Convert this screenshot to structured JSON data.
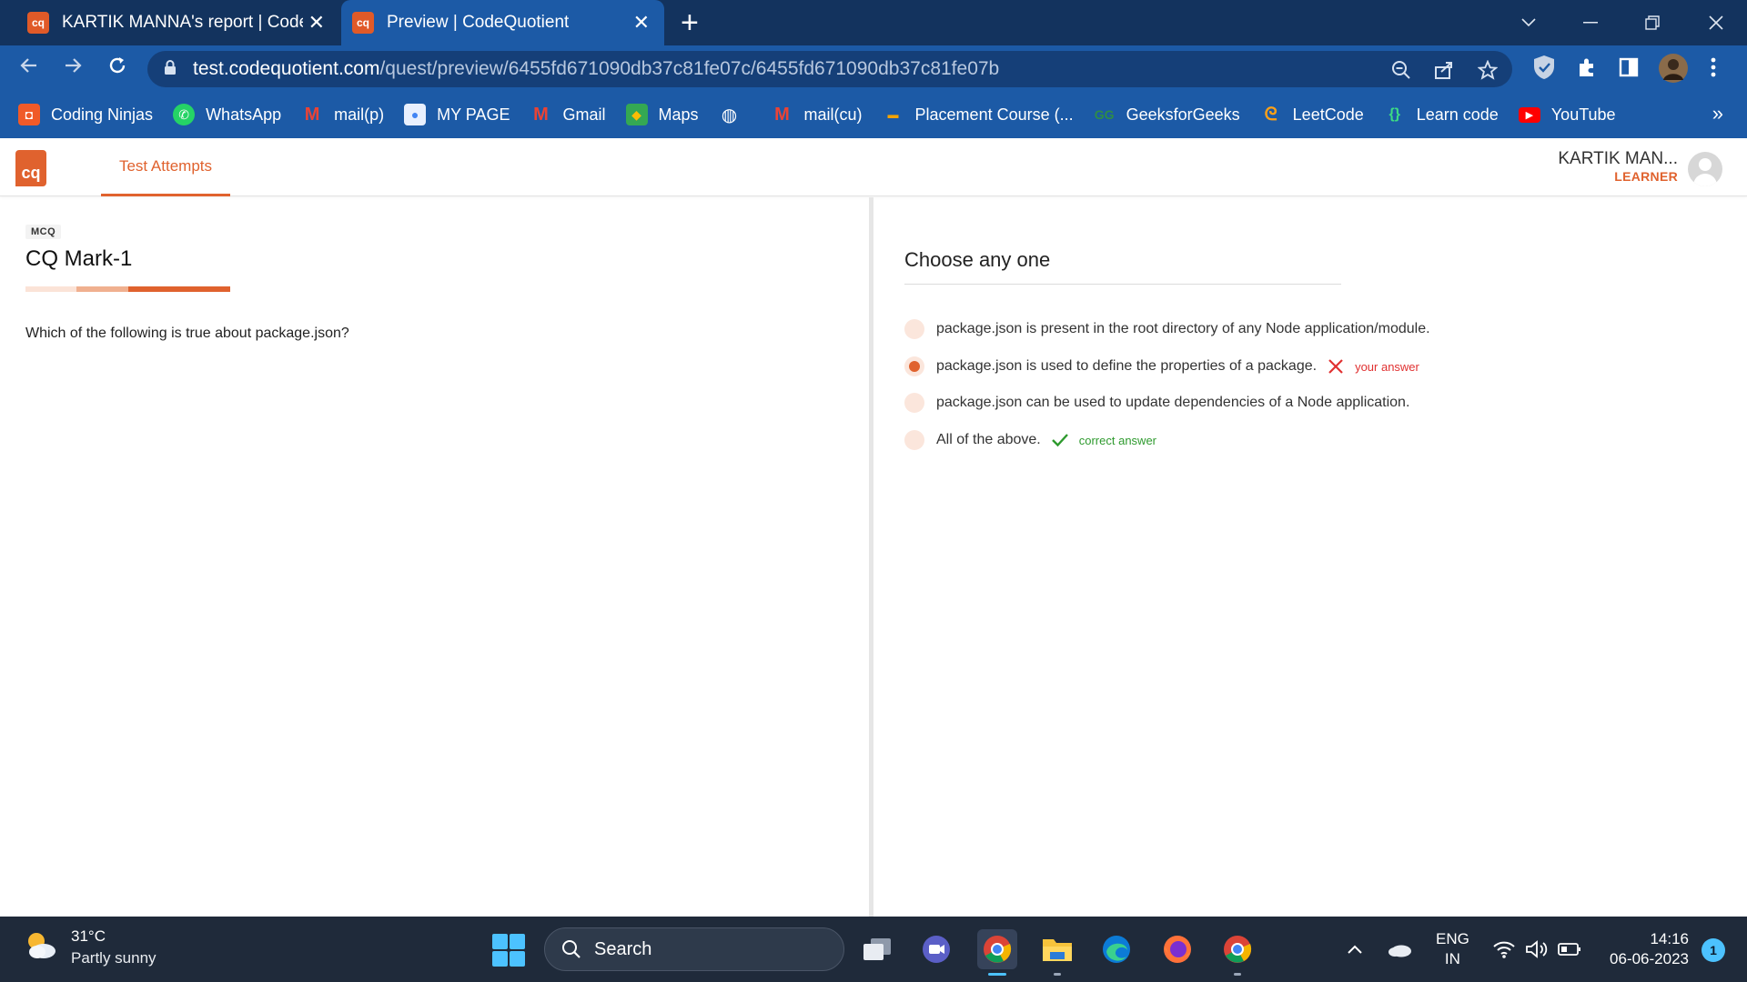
{
  "browser": {
    "tabs": [
      {
        "title": "KARTIK MANNA's report | CodeQ",
        "favicon": "cq",
        "active": false
      },
      {
        "title": "Preview | CodeQuotient",
        "favicon": "cq",
        "active": true
      }
    ],
    "url_host": "test.codequotient.com",
    "url_path": "/quest/preview/6455fd671090db37c81fe07c/6455fd671090db37c81fe07b",
    "bookmarks": [
      {
        "label": "Coding Ninjas",
        "icon": "coding-ninjas-icon",
        "color": "#f05a28"
      },
      {
        "label": "WhatsApp",
        "icon": "whatsapp-icon",
        "color": "#25d366"
      },
      {
        "label": "mail(p)",
        "icon": "gmail-icon",
        "color": "#ea4335"
      },
      {
        "label": "MY PAGE",
        "icon": "profile-icon",
        "color": "#4285f4"
      },
      {
        "label": "Gmail",
        "icon": "gmail-icon",
        "color": "#ea4335"
      },
      {
        "label": "Maps",
        "icon": "maps-icon",
        "color": "#34a853"
      },
      {
        "label": "",
        "icon": "globe-icon",
        "color": "#ffffff"
      },
      {
        "label": "mail(cu)",
        "icon": "gmail-icon",
        "color": "#ea4335"
      },
      {
        "label": "Placement Course (...",
        "icon": "placement-icon",
        "color": "#f4a300"
      },
      {
        "label": "GeeksforGeeks",
        "icon": "gfg-icon",
        "color": "#2f8d46"
      },
      {
        "label": "LeetCode",
        "icon": "leetcode-icon",
        "color": "#ffa116"
      },
      {
        "label": "Learn code",
        "icon": "code-brackets-icon",
        "color": "#3ddc84"
      },
      {
        "label": "YouTube",
        "icon": "youtube-icon",
        "color": "#ff0000"
      }
    ],
    "more_bookmarks": "»"
  },
  "app": {
    "logo": "cq",
    "nav_tab": "Test Attempts",
    "user_name": "KARTIK MAN...",
    "user_role": "LEARNER",
    "accent": "#e0622e"
  },
  "question": {
    "type": "MCQ",
    "title": "CQ Mark-1",
    "text": "Which of the following is true about package.json?"
  },
  "answer_panel": {
    "heading": "Choose any one",
    "options": [
      {
        "text": "package.json is present in the root directory of any Node application/module.",
        "selected": false,
        "mark": ""
      },
      {
        "text": "package.json is used to define the properties of a package.",
        "selected": true,
        "mark": "your answer"
      },
      {
        "text": "package.json can be used to update dependencies of a Node application.",
        "selected": false,
        "mark": ""
      },
      {
        "text": "All of the above.",
        "selected": false,
        "mark": "correct answer"
      }
    ]
  },
  "taskbar": {
    "weather_temp": "31°C",
    "weather_desc": "Partly sunny",
    "search_label": "Search",
    "lang_line1": "ENG",
    "lang_line2": "IN",
    "time": "14:16",
    "date": "06-06-2023",
    "notifications": "1"
  }
}
